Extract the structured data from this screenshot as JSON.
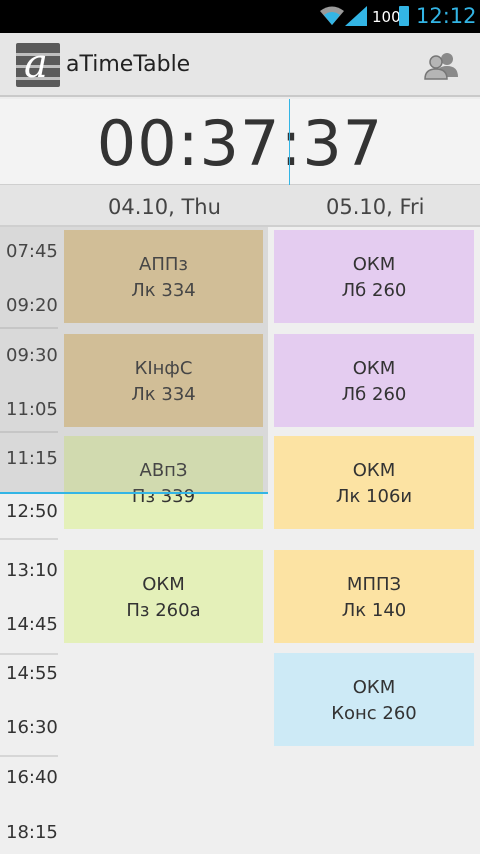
{
  "status_bar": {
    "battery": "100",
    "clock": "12:12"
  },
  "app": {
    "title": "aTimeTable",
    "logo_letter": "a"
  },
  "timer": {
    "value": "00:37:37"
  },
  "days": [
    "04.10, Thu",
    "05.10, Fri"
  ],
  "times": [
    "07:45",
    "09:20",
    "09:30",
    "11:05",
    "11:15",
    "12:50",
    "13:10",
    "14:45",
    "14:55",
    "16:30",
    "16:40",
    "18:15"
  ],
  "colors": {
    "status_bar": "#000000",
    "accent": "#33b5e5",
    "lab_purple": "#e4ccf0",
    "lecture_tan": "#e5cc9a",
    "yellow": "#fce3a3",
    "green": "#e4f0b9",
    "blue": "#cdeaf6"
  },
  "lessons": {
    "thu": [
      {
        "subject": "АППз",
        "room": "Лк 334"
      },
      {
        "subject": "КІнфС",
        "room": "Лк 334"
      },
      {
        "subject": "АВпЗ",
        "room": "Пз 339"
      },
      {
        "subject": "ОКМ",
        "room": "Пз 260а"
      }
    ],
    "fri": [
      {
        "subject": "ОКМ",
        "room": "Лб 260"
      },
      {
        "subject": "ОКМ",
        "room": "Лб 260"
      },
      {
        "subject": "ОКМ",
        "room": "Лк 106и"
      },
      {
        "subject": "МППЗ",
        "room": "Лк 140"
      },
      {
        "subject": "ОКМ",
        "room": "Конс 260"
      }
    ]
  }
}
